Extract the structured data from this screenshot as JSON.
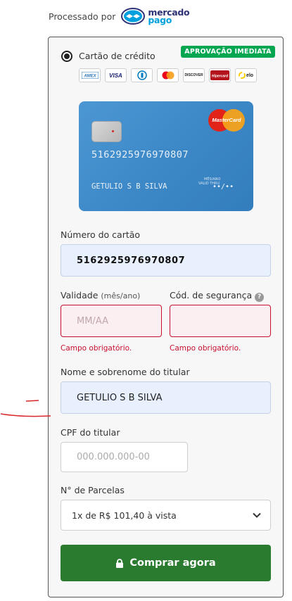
{
  "header": {
    "processed_by": "Processado por",
    "logo_line1": "mercado",
    "logo_line2": "pago"
  },
  "payment_method": {
    "label": "Cartão de crédito",
    "badge": "APROVAÇÃO IMEDIATA",
    "brands": [
      "AMEX",
      "VISA",
      "Diners",
      "Mastercard",
      "DISCOVER",
      "Hipercard",
      "elo"
    ]
  },
  "card_preview": {
    "number": "5162925976970807",
    "holder": "GETULIO S B SILVA",
    "valid_label": "VALID THRU",
    "valid_small": "MÊS/ANO",
    "expiry": "••/••",
    "brand_text": "MasterCard"
  },
  "form": {
    "card_number": {
      "label": "Número do cartão",
      "value": "5162925976970807"
    },
    "expiry": {
      "label": "Validade",
      "hint": "(mês/ano)",
      "placeholder": "MM/AA",
      "error": "Campo obrigatório."
    },
    "cvv": {
      "label": "Cód. de segurança",
      "help": "?",
      "error": "Campo obrigatório."
    },
    "holder": {
      "label": "Nome e sobrenome do titular",
      "value": "GETULIO S B SILVA"
    },
    "cpf": {
      "label": "CPF do titular",
      "placeholder": "000.000.000-00"
    },
    "installments": {
      "label": "N° de Parcelas",
      "selected": "1x de R$ 101,40 à vista"
    }
  },
  "submit": {
    "label": "Comprar agora"
  },
  "colors": {
    "accent_green": "#2a7b30",
    "badge_green": "#00a650",
    "error_red": "#c8102e",
    "filled_bg": "#e8f0fe"
  }
}
